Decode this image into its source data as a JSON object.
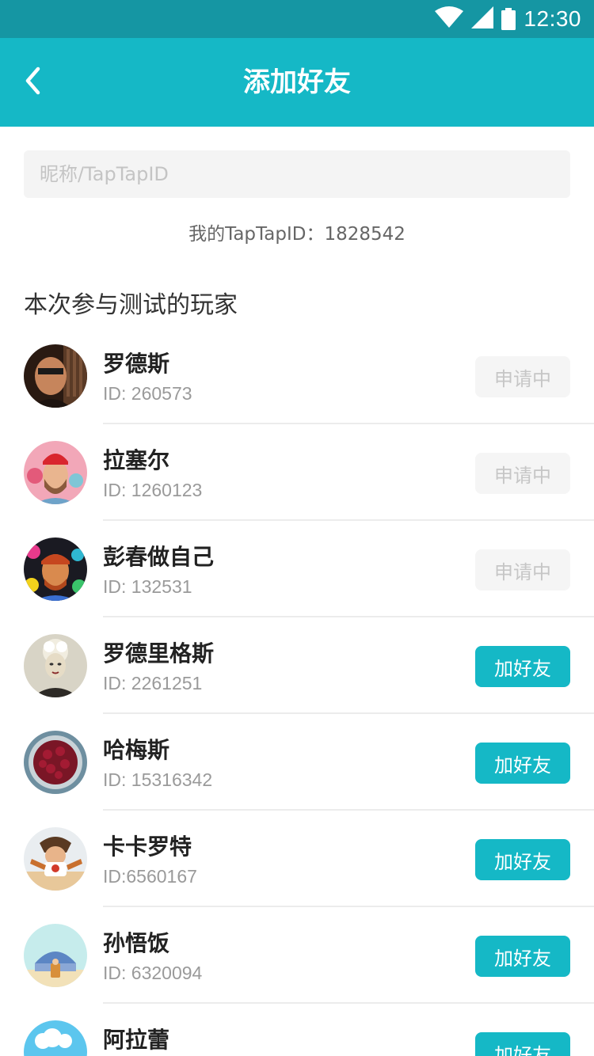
{
  "status_bar": {
    "time": "12:30",
    "icons": [
      "wifi-icon",
      "cellular-signal-icon",
      "battery-icon"
    ]
  },
  "app_bar": {
    "title": "添加好友",
    "back_icon": "chevron-left-icon"
  },
  "search": {
    "placeholder": "昵称/TapTapID",
    "value": ""
  },
  "my_id": {
    "text": "我的TapTapID：1828542"
  },
  "section": {
    "title": "本次参与测试的玩家"
  },
  "players": [
    {
      "name": "罗德斯",
      "id": "ID: 260573",
      "action": "申请中",
      "state": "pending"
    },
    {
      "name": "拉塞尔",
      "id": "ID: 1260123",
      "action": "申请中",
      "state": "pending"
    },
    {
      "name": "彭春做自己",
      "id": "ID: 132531",
      "action": "申请中",
      "state": "pending"
    },
    {
      "name": "罗德里格斯",
      "id": "ID: 2261251",
      "action": "加好友",
      "state": "add"
    },
    {
      "name": "哈梅斯",
      "id": "ID: 15316342",
      "action": "加好友",
      "state": "add"
    },
    {
      "name": "卡卡罗特",
      "id": "ID:6560167",
      "action": "加好友",
      "state": "add"
    },
    {
      "name": "孙悟饭",
      "id": "ID: 6320094",
      "action": "加好友",
      "state": "add"
    },
    {
      "name": "阿拉蕾",
      "id": "",
      "action": "加好友",
      "state": "add"
    }
  ],
  "colors": {
    "status_bar": "#1596a3",
    "app_bar": "#15b8c6",
    "accent": "#15b8c6",
    "pending_bg": "#f5f5f5",
    "pending_text": "#c6c6c6"
  }
}
